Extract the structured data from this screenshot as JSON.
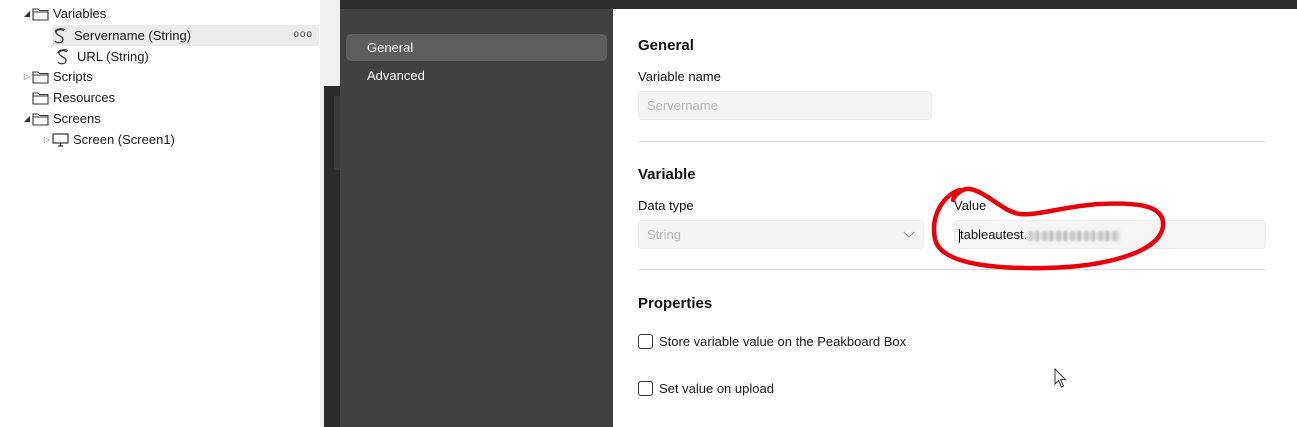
{
  "tree": {
    "items": [
      {
        "label": "Variables",
        "kind": "folder",
        "expanded": true
      },
      {
        "label": "Servername (String)",
        "kind": "variable",
        "selected": true,
        "more_label": "ooo"
      },
      {
        "label": "URL (String)",
        "kind": "variable"
      },
      {
        "label": "Scripts",
        "kind": "folder",
        "expanded": false
      },
      {
        "label": "Resources",
        "kind": "folder"
      },
      {
        "label": "Screens",
        "kind": "folder",
        "expanded": true
      },
      {
        "label": "Screen (Screen1)",
        "kind": "screen",
        "expanded": false
      }
    ]
  },
  "dialog": {
    "nav": [
      {
        "label": "General",
        "active": true
      },
      {
        "label": "Advanced",
        "active": false
      }
    ],
    "general": {
      "heading": "General",
      "name_label": "Variable name",
      "name_placeholder": "Servername"
    },
    "variable": {
      "heading": "Variable",
      "datatype_label": "Data type",
      "datatype_value": "String",
      "value_label": "Value",
      "value_text": "tableautest."
    },
    "properties": {
      "heading": "Properties",
      "store_label": "Store variable value on the Peakboard Box",
      "store_checked": false,
      "upload_label": "Set value on upload",
      "upload_checked": false
    }
  },
  "colors": {
    "nav_bg": "#414141",
    "nav_active": "#5e5e5e",
    "annotation": "#e8000b"
  },
  "icons": [
    "folder-icon",
    "variable-icon",
    "screen-icon",
    "expand-triangle-icon",
    "chevron-down-icon",
    "mouse-cursor-icon"
  ]
}
